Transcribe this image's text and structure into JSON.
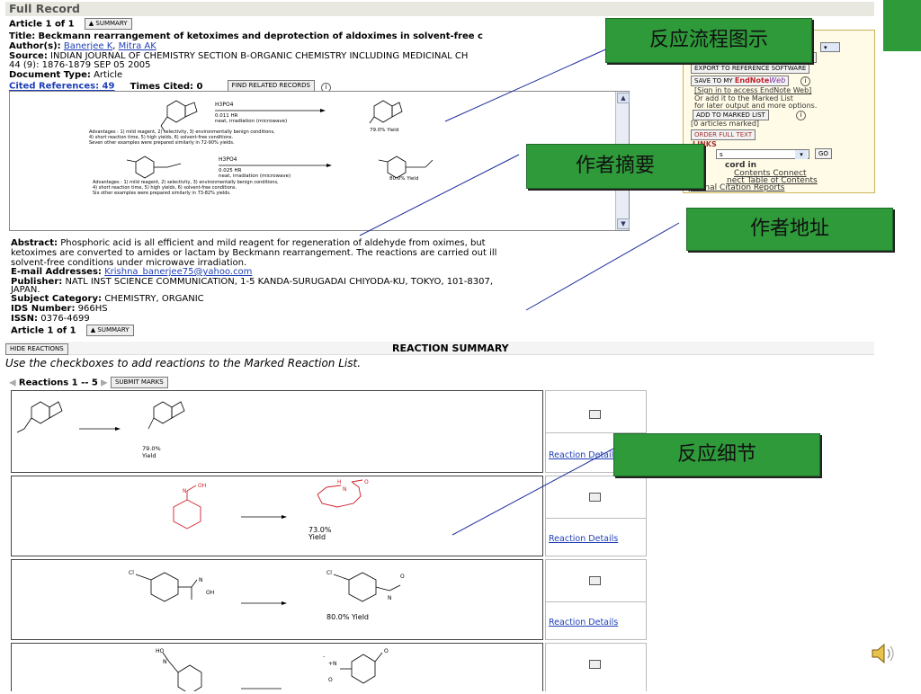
{
  "header": {
    "title": "Full Record",
    "article_count": "Article 1 of 1",
    "summary_btn": "▲ SUMMARY"
  },
  "record": {
    "title_label": "Title:",
    "title_value": "Beckmann rearrangement of ketoximes and deprotection of aldoximes in solvent-free c",
    "authors_label": "Author(s):",
    "authors": [
      "Banerjee K",
      "Mitra AK"
    ],
    "source_label": "Source:",
    "source_value": "INDIAN JOURNAL OF CHEMISTRY SECTION B-ORGANIC CHEMISTRY INCLUDING MEDICINAL CH",
    "source_line2": "44 (9): 1876-1879 SEP 05 2005",
    "doc_type_label": "Document Type:",
    "doc_type_value": "Article",
    "cited_refs": "Cited References: 49",
    "times_cited": "Times Cited: 0",
    "find_related": "FIND RELATED RECORDS",
    "abstract_label": "Abstract:",
    "abstract_lines": [
      "Phosphoric acid is all efficient and mild reagent for regeneration of aldehyde from oximes, but",
      "ketoximes are converted to amides or lactam by Beckmann rearrangement. The reactions are carried out ill",
      "solvent-free conditions under microwave irradiation."
    ],
    "email_label": "E-mail Addresses:",
    "email_value": "Krishna_banerjee75@yahoo.com",
    "publisher_label": "Publisher:",
    "publisher_value": "NATL INST SCIENCE COMMUNICATION, 1-5 KANDA-SURUGADAI CHIYODA-KU, TOKYO, 101-8307,",
    "publisher_line2": "JAPAN.",
    "subject_label": "Subject Category:",
    "subject_value": "CHEMISTRY, ORGANIC",
    "ids_label": "IDS Number:",
    "ids_value": "966HS",
    "issn_label": "ISSN:",
    "issn_value": "0376-4699",
    "article_count_bottom": "Article 1 of 1",
    "summary_btn_bottom": "▲ SUMMARY"
  },
  "scheme": {
    "r1_reagent": "H3PO4",
    "r1_cond1": "0.011 HR",
    "r1_cond2": "neat, irradiation (microwave)",
    "r1_yield": "79.0% Yield",
    "r1_adv1": "Advantages : 1) mild reagent, 2) selectivity, 3) environmentally benign conditions,",
    "r1_adv2": "4) short reaction time, 5) high yields, 6) solvent-free conditions.",
    "r1_adv3": "Seven other examples were prepared similarly in 72-90% yields.",
    "r2_reagent": "H3PO4",
    "r2_cond1": "0.025 HR",
    "r2_cond2": "neat, irradiation (microwave)",
    "r2_yield": "80.0% Yield",
    "r2_adv1": "Advantages : 1) mild reagent, 2) selectivity, 3) environmentally benign conditions,",
    "r2_adv2": "4) short reaction time, 5) high yields, 6) solvent-free conditions.",
    "r2_adv3": "Six other examples were prepared similarly in 73-82% yields."
  },
  "panel": {
    "save": "SAVE",
    "export": "EXPORT TO REFERENCE SOFTWARE",
    "save_endnote": "SAVE TO MY",
    "endnote_brand": "EndNote",
    "endnote_web": "Web",
    "sign_in": "[Sign in to access EndNote Web]",
    "or_add1": "Or add it to the Marked List",
    "or_add2": "for later output and more options.",
    "add_marked": "ADD TO MARKED LIST",
    "marked_count": "[0 articles marked]",
    "order_full_text": "ORDER FULL TEXT",
    "links_label": "LINKS",
    "select_value": "s",
    "go": "GO",
    "record_in": "cord in",
    "contents_connect": "Contents Connect",
    "nect_toc": "nect Table of Contents",
    "journal_citation": "Journal Citation Reports"
  },
  "reaction_summary": {
    "hide_btn": "HIDE REACTIONS",
    "title": "REACTION SUMMARY",
    "instructions": "Use the checkboxes to add reactions to the Marked Reaction List.",
    "range": "Reactions 1 -- 5",
    "submit_marks": "SUBMIT MARKS",
    "details_label": "Reaction Details",
    "r1_yield": "79.0%",
    "r1_yield_word": "Yield",
    "r2_yield": "73.0%",
    "r2_yield_word": "Yield",
    "r3_yield": "80.0% Yield"
  },
  "annotations": {
    "flow_diagram": "反应流程图示",
    "abstract": "作者摘要",
    "address": "作者地址",
    "details": "反应细节"
  },
  "colors": {
    "accent_green": "#2e9a3a",
    "link_blue": "#1f3fb8",
    "highlight_red": "#d0202a"
  },
  "icons": {
    "speaker": "speaker-icon"
  }
}
